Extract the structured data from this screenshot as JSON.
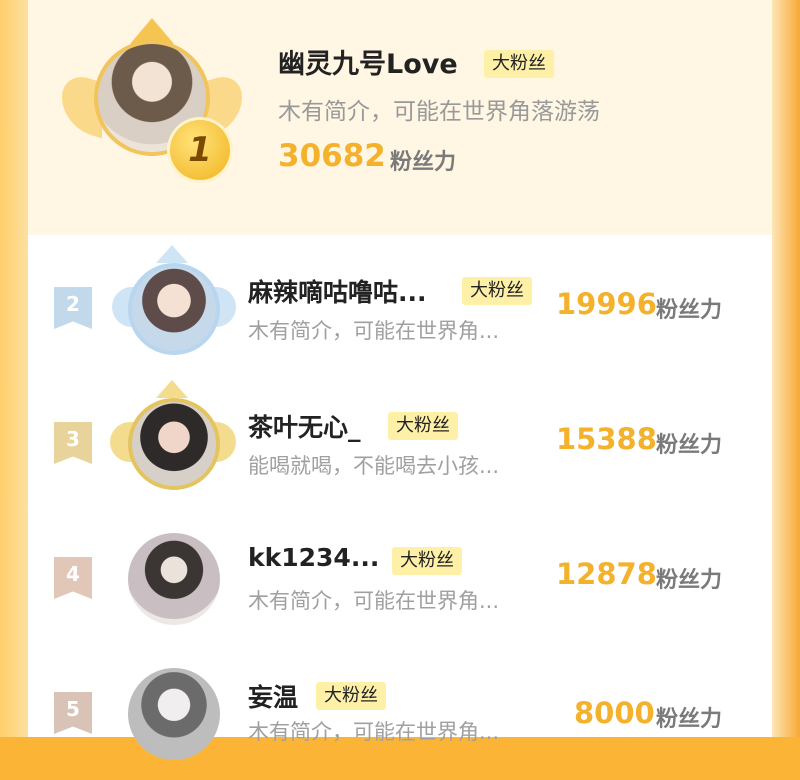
{
  "top": {
    "rank": "1",
    "name": "幽灵九号Love",
    "badge": "大粉丝",
    "bio": "木有简介，可能在世界角落游荡",
    "score": "30682",
    "unit": "粉丝力"
  },
  "rows": [
    {
      "rank": "2",
      "name": "麻辣嘀咕噜咕...",
      "badge": "大粉丝",
      "bio": "木有简介，可能在世界角...",
      "score": "19996",
      "unit": "粉丝力"
    },
    {
      "rank": "3",
      "name": "茶叶无心_",
      "badge": "大粉丝",
      "bio": "能喝就喝，不能喝去小孩...",
      "score": "15388",
      "unit": "粉丝力"
    },
    {
      "rank": "4",
      "name": "kk1234...",
      "badge": "大粉丝",
      "bio": "木有简介，可能在世界角...",
      "score": "12878",
      "unit": "粉丝力"
    },
    {
      "rank": "5",
      "name": "妄温",
      "badge": "大粉丝",
      "bio": "木有简介，可能在世界角...",
      "score": "8000",
      "unit": "粉丝力"
    }
  ],
  "colors": {
    "accent": "#f3b12c",
    "badge_bg": "#fff0a8",
    "frame": "#fbb436"
  }
}
